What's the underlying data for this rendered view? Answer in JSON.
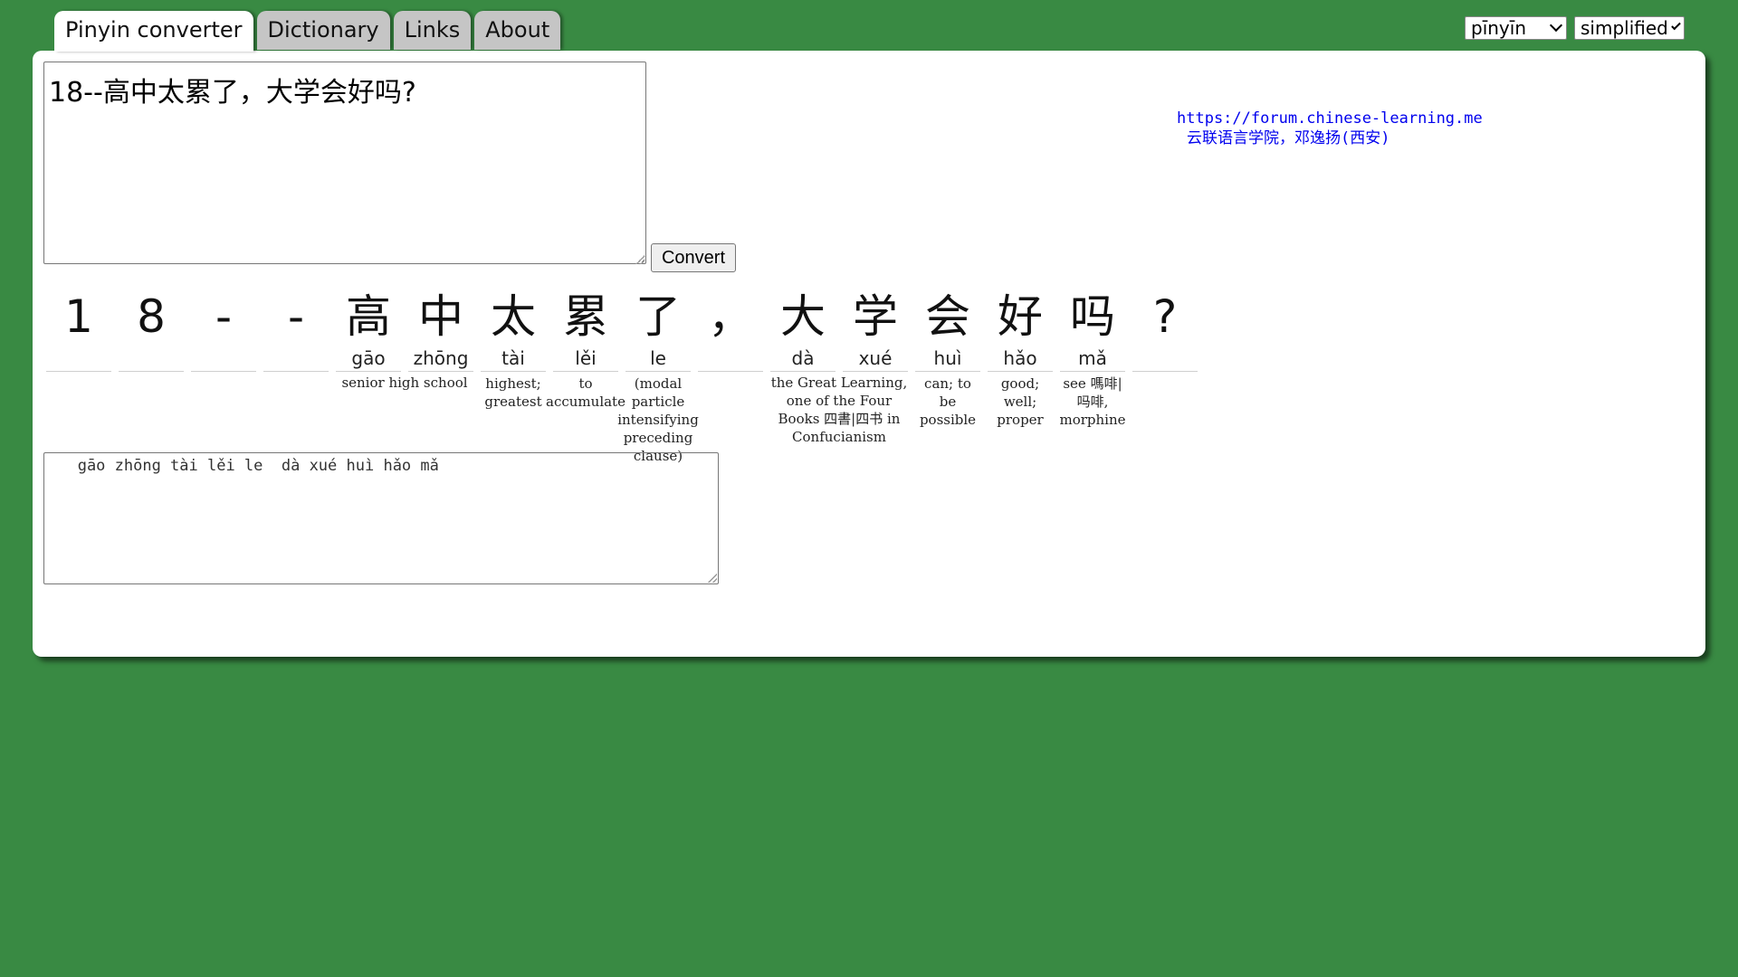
{
  "tabs": [
    {
      "label": "Pinyin converter",
      "active": true
    },
    {
      "label": "Dictionary",
      "active": false
    },
    {
      "label": "Links",
      "active": false
    },
    {
      "label": "About",
      "active": false
    }
  ],
  "selects": {
    "romanization": "pīnyīn",
    "script": "simplified"
  },
  "input": {
    "value": "18--高中太累了，大学会好吗?"
  },
  "convert_label": "Convert",
  "credit": {
    "url": "https://forum.chinese-learning.me",
    "text": "云联语言学院，邓逸扬(西安)"
  },
  "characters": [
    {
      "hanzi": "1",
      "pinyin": ""
    },
    {
      "hanzi": "8",
      "pinyin": ""
    },
    {
      "hanzi": "-",
      "pinyin": ""
    },
    {
      "hanzi": "-",
      "pinyin": ""
    },
    {
      "hanzi": "高",
      "pinyin": "gāo"
    },
    {
      "hanzi": "中",
      "pinyin": "zhōng"
    },
    {
      "hanzi": "太",
      "pinyin": "tài"
    },
    {
      "hanzi": "累",
      "pinyin": "lěi"
    },
    {
      "hanzi": "了",
      "pinyin": "le"
    },
    {
      "hanzi": "，",
      "pinyin": ""
    },
    {
      "hanzi": "大",
      "pinyin": "dà"
    },
    {
      "hanzi": "学",
      "pinyin": "xué"
    },
    {
      "hanzi": "会",
      "pinyin": "huì"
    },
    {
      "hanzi": "好",
      "pinyin": "hǎo"
    },
    {
      "hanzi": "吗",
      "pinyin": "mǎ"
    },
    {
      "hanzi": "?",
      "pinyin": ""
    }
  ],
  "definitions": {
    "gaozhong": "senior high school",
    "tai": "highest; greatest",
    "lei": "to accumulate",
    "le": "(modal particle intensifying preceding clause)",
    "daxue": "the Great Learning, one of the Four Books 四書|四书 in Confucianism",
    "hui": "can; to be possible",
    "hao": "good; well; proper",
    "ma": "see 嗎啡|吗啡, morphine"
  },
  "output": {
    "value": "   gāo zhōng tài lěi le  dà xué huì hǎo mǎ"
  }
}
